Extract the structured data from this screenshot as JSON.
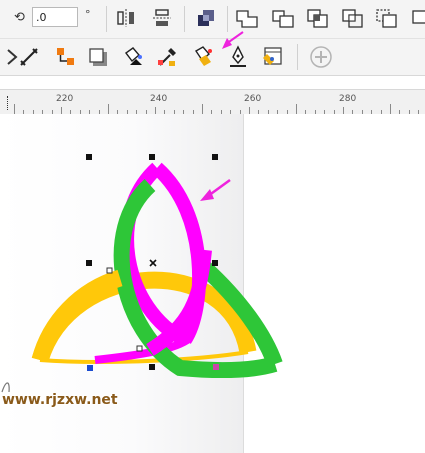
{
  "toolbar": {
    "rotation_value": ".0",
    "degree_symbol": "°",
    "add_symbol": "+"
  },
  "ruler": {
    "labels": [
      "220",
      "240",
      "260",
      "280"
    ]
  },
  "colors": {
    "magenta": "#ff00ff",
    "green": "#2ec638",
    "yellow": "#ffc80a",
    "arrow": "#ee22dd",
    "handle": "#111111"
  },
  "canvas": {
    "watermark": "www.rjzxw.net"
  }
}
